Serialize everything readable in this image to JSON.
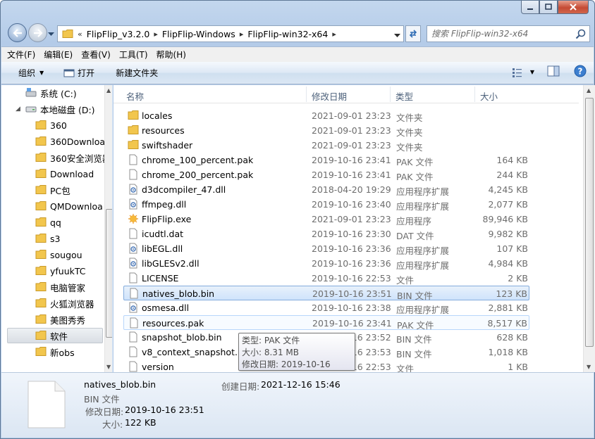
{
  "window": {
    "minimize": "",
    "maximize": "",
    "close": ""
  },
  "address": {
    "overflow": "«",
    "crumbs": [
      "FlipFlip_v3.2.0",
      "FlipFlip-Windows",
      "FlipFlip-win32-x64"
    ]
  },
  "search": {
    "placeholder": "搜索 FlipFlip-win32-x64"
  },
  "menu": [
    "文件(F)",
    "编辑(E)",
    "查看(V)",
    "工具(T)",
    "帮助(H)"
  ],
  "toolbar": {
    "organize": "组织",
    "open": "打开",
    "new_folder": "新建文件夹"
  },
  "nav": {
    "drive_c": "系统 (C:)",
    "drive_d": "本地磁盘 (D:)",
    "folders": [
      "360",
      "360Downloa",
      "360安全浏览器",
      "Download",
      "PC包",
      "QMDownloa",
      "qq",
      "s3",
      "sougou",
      "yfuukTC",
      "电脑管家",
      "火狐浏览器",
      "美图秀秀",
      "软件",
      "新obs"
    ],
    "selected": "软件"
  },
  "columns": {
    "name": "名称",
    "date": "修改日期",
    "type": "类型",
    "size": "大小"
  },
  "files": [
    {
      "name": "locales",
      "date": "2021-09-01 23:23",
      "type": "文件夹",
      "size": "",
      "icon": "folder"
    },
    {
      "name": "resources",
      "date": "2021-09-01 23:23",
      "type": "文件夹",
      "size": "",
      "icon": "folder"
    },
    {
      "name": "swiftshader",
      "date": "2021-09-01 23:23",
      "type": "文件夹",
      "size": "",
      "icon": "folder"
    },
    {
      "name": "chrome_100_percent.pak",
      "date": "2019-10-16 23:41",
      "type": "PAK 文件",
      "size": "164 KB",
      "icon": "file"
    },
    {
      "name": "chrome_200_percent.pak",
      "date": "2019-10-16 23:41",
      "type": "PAK 文件",
      "size": "244 KB",
      "icon": "file"
    },
    {
      "name": "d3dcompiler_47.dll",
      "date": "2018-04-20 19:29",
      "type": "应用程序扩展",
      "size": "4,245 KB",
      "icon": "dll"
    },
    {
      "name": "ffmpeg.dll",
      "date": "2019-10-16 23:40",
      "type": "应用程序扩展",
      "size": "2,077 KB",
      "icon": "dll"
    },
    {
      "name": "FlipFlip.exe",
      "date": "2021-09-01 23:23",
      "type": "应用程序",
      "size": "89,946 KB",
      "icon": "exe"
    },
    {
      "name": "icudtl.dat",
      "date": "2019-10-16 23:30",
      "type": "DAT 文件",
      "size": "9,982 KB",
      "icon": "file"
    },
    {
      "name": "libEGL.dll",
      "date": "2019-10-16 23:36",
      "type": "应用程序扩展",
      "size": "107 KB",
      "icon": "dll"
    },
    {
      "name": "libGLESv2.dll",
      "date": "2019-10-16 23:36",
      "type": "应用程序扩展",
      "size": "4,984 KB",
      "icon": "dll"
    },
    {
      "name": "LICENSE",
      "date": "2019-10-16 22:53",
      "type": "文件",
      "size": "2 KB",
      "icon": "file"
    },
    {
      "name": "natives_blob.bin",
      "date": "2019-10-16 23:51",
      "type": "BIN 文件",
      "size": "123 KB",
      "icon": "file"
    },
    {
      "name": "osmesa.dll",
      "date": "2019-10-16 23:38",
      "type": "应用程序扩展",
      "size": "2,881 KB",
      "icon": "dll"
    },
    {
      "name": "resources.pak",
      "date": "2019-10-16 23:41",
      "type": "PAK 文件",
      "size": "8,517 KB",
      "icon": "file"
    },
    {
      "name": "snapshot_blob.bin",
      "date": "2019-10-16 23:52",
      "type": "BIN 文件",
      "size": "628 KB",
      "icon": "file"
    },
    {
      "name": "v8_context_snapshot.bin",
      "date": "2019-10-16 23:53",
      "type": "BIN 文件",
      "size": "1,018 KB",
      "icon": "file"
    },
    {
      "name": "version",
      "date": "2019-10-16 22:53",
      "type": "文件",
      "size": "1 KB",
      "icon": "file"
    }
  ],
  "selected_file": "natives_blob.bin",
  "hovered_file": "resources.pak",
  "tooltip": {
    "type": "类型: PAK 文件",
    "size": "大小: 8.31 MB",
    "modified": "修改日期: 2019-10-16 23:41"
  },
  "details": {
    "name": "natives_blob.bin",
    "type": "BIN 文件",
    "modified_label": "修改日期:",
    "modified": "2019-10-16 23:51",
    "size_label": "大小:",
    "size": "122 KB",
    "created_label": "创建日期:",
    "created": "2021-12-16 15:46"
  },
  "colors": {
    "selection": "#cfe3fb",
    "selection_border": "#84acdd",
    "folder": "#f2c64d",
    "chrome": "#b4cbe8"
  }
}
